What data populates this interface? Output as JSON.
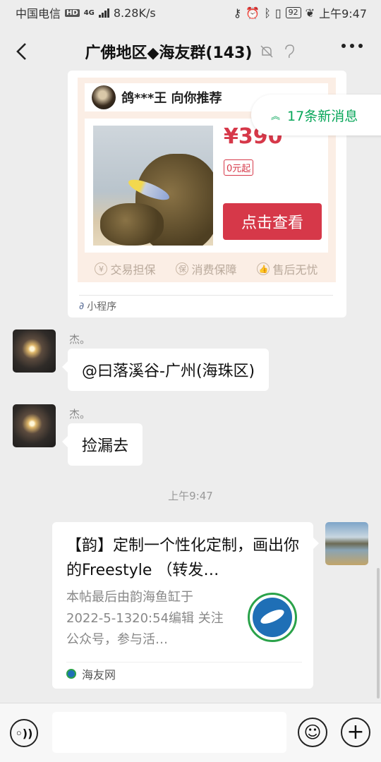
{
  "status_bar": {
    "carrier": "中国电信",
    "hd": "HD",
    "network": "4G",
    "speed": "8.28K/s",
    "battery": "92",
    "time": "上午9:47"
  },
  "header": {
    "title": "广佛地区◆海友群(143)"
  },
  "new_messages": {
    "label": "17条新消息"
  },
  "mini_program_card": {
    "recommender": "鸽***王 向你推荐",
    "price": "¥390",
    "price_tag": "0元起",
    "button_label": "点击查看",
    "guarantees": [
      "交易担保",
      "消费保障",
      "售后无忧"
    ],
    "guarantee_icons": [
      "¥",
      "保",
      "👍"
    ],
    "footer": "小程序"
  },
  "messages": [
    {
      "sender": "杰。",
      "text": "@曰落溪谷-广州(海珠区)"
    },
    {
      "sender": "杰。",
      "text": "捡漏去"
    }
  ],
  "timestamp": "上午9:47",
  "link_card": {
    "title": "【韵】定制一个性化定制，画出你的Freestyle （转发…",
    "description": "本帖最后由韵海鱼缸于 2022-5-1320:54编辑 关注公众号，参与活…",
    "source": "海友网"
  },
  "colors": {
    "accent_green": "#07a659",
    "price_red": "#d63849",
    "background": "#ededed"
  }
}
